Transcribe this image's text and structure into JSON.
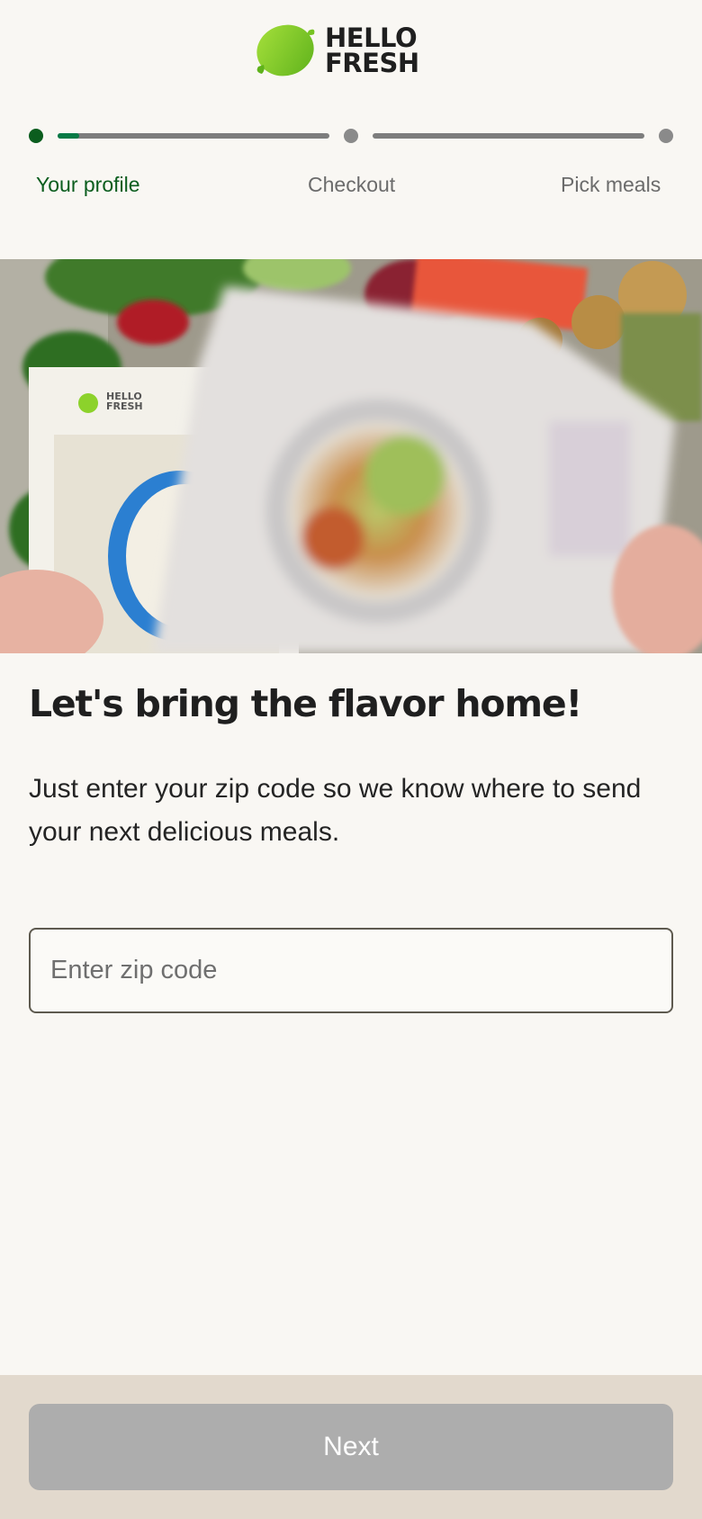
{
  "header": {
    "logo_line1": "HELLO",
    "logo_line2": "FRESH",
    "brand_color": "#8cd22b"
  },
  "stepper": {
    "steps": [
      {
        "label": "Your profile",
        "state": "active"
      },
      {
        "label": "Checkout",
        "state": "inactive"
      },
      {
        "label": "Pick meals",
        "state": "inactive"
      }
    ],
    "progress_segment1": 0.08,
    "progress_segment2": 0,
    "active_color": "#0b5d1e",
    "inactive_color": "#8a8a8a"
  },
  "hero": {
    "alt": "HelloFresh recipe cards being flipped over a box of fresh produce"
  },
  "main": {
    "title": "Let's bring the flavor home!",
    "subtitle": "Just enter your zip code so we know where to send your next delicious meals.",
    "zip": {
      "placeholder": "Enter zip code",
      "value": ""
    }
  },
  "footer": {
    "next_label": "Next",
    "next_enabled": false
  }
}
